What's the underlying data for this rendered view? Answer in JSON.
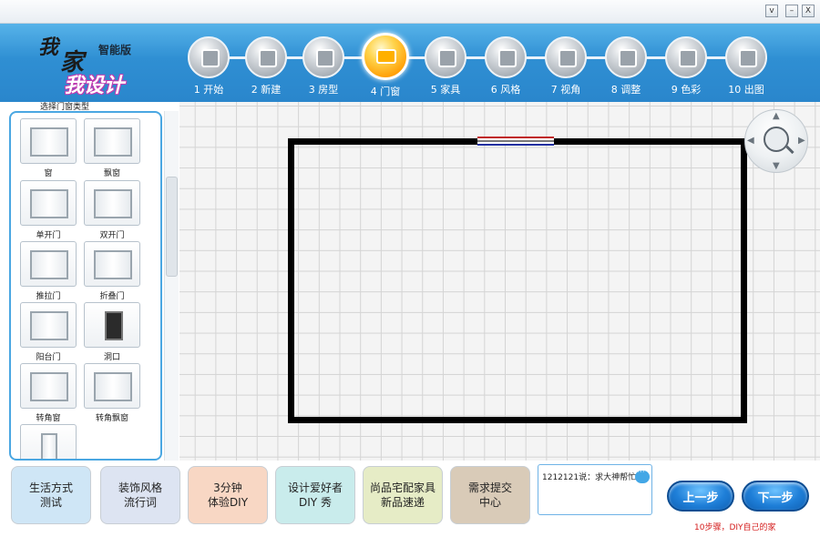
{
  "window": {
    "minimize_label": "–",
    "close_label": "X",
    "menu_label": "v"
  },
  "logo": {
    "char1": "我",
    "char2": "家",
    "char3": "我设计",
    "edition": "智能版"
  },
  "steps": [
    {
      "label": "1 开始",
      "icon": "arrow-right-icon",
      "active": false
    },
    {
      "label": "2 新建",
      "icon": "new-document-icon",
      "active": false
    },
    {
      "label": "3 房型",
      "icon": "room-layout-icon",
      "active": false
    },
    {
      "label": "4 门窗",
      "icon": "door-window-icon",
      "active": true
    },
    {
      "label": "5 家具",
      "icon": "furniture-icon",
      "active": false
    },
    {
      "label": "6 风格",
      "icon": "style-brush-icon",
      "active": false
    },
    {
      "label": "7 视角",
      "icon": "view-cube-icon",
      "active": false
    },
    {
      "label": "8 调整",
      "icon": "adjust-chair-icon",
      "active": false
    },
    {
      "label": "9 色彩",
      "icon": "color-palette-icon",
      "active": false
    },
    {
      "label": "10 出图",
      "icon": "render-camera-icon",
      "active": false
    }
  ],
  "sidebar": {
    "caption": "选择门窗类型",
    "items": [
      {
        "label": "窗"
      },
      {
        "label": "飘窗"
      },
      {
        "label": "单开门"
      },
      {
        "label": "双开门"
      },
      {
        "label": "推拉门"
      },
      {
        "label": "折叠门"
      },
      {
        "label": "阳台门"
      },
      {
        "label": "洞口"
      },
      {
        "label": "转角窗"
      },
      {
        "label": "转角飘窗"
      },
      {
        "label": ""
      }
    ]
  },
  "bottom": {
    "buttons": [
      {
        "label": "生活方式\n测试",
        "color": "#cfe6f6"
      },
      {
        "label": "装饰风格\n流行词",
        "color": "#dde4f2"
      },
      {
        "label": "3分钟\n体验DIY",
        "color": "#f8d7c4"
      },
      {
        "label": "设计爱好者\nDIY 秀",
        "color": "#c9ecec"
      },
      {
        "label": "尚品宅配家具\n新品速递",
        "color": "#e6ecc6"
      },
      {
        "label": "需求提交\n中心",
        "color": "#d9cbb8"
      }
    ],
    "chat_text": "1212121说：求大神帮忙",
    "prev_label": "上一步",
    "next_label": "下一步",
    "hint": "10步骤，DIY自己的家"
  }
}
